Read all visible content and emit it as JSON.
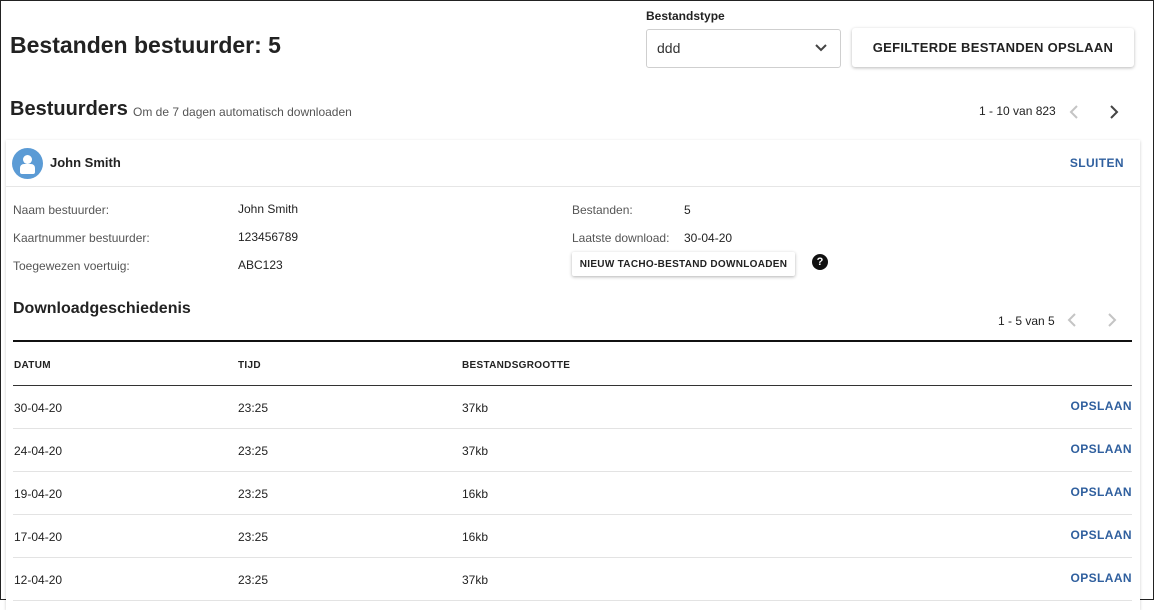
{
  "page": {
    "title": "Bestanden bestuurder: 5"
  },
  "filter": {
    "label": "Bestandstype",
    "value": "ddd",
    "save_button": "GEFILTERDE BESTANDEN OPSLAAN"
  },
  "drivers": {
    "title": "Bestuurders",
    "subtitle": "Om de 7 dagen automatisch downloaden",
    "pagination": "1 - 10 van 823"
  },
  "driver_card": {
    "name": "John Smith",
    "close_label": "SLUITEN",
    "fields_left": [
      {
        "label": "Naam bestuurder:",
        "value": "John Smith"
      },
      {
        "label": "Kaartnummer bestuurder:",
        "value": "123456789"
      },
      {
        "label": "Toegewezen voertuig:",
        "value": "ABC123"
      }
    ],
    "fields_right": [
      {
        "label": "Bestanden:",
        "value": "5"
      },
      {
        "label": "Laatste download:",
        "value": "30-04-20"
      }
    ],
    "download_button": "NIEUW TACHO-BESTAND DOWNLOADEN",
    "help_glyph": "?"
  },
  "history": {
    "title": "Downloadgeschiedenis",
    "pagination": "1 - 5 van 5",
    "columns": [
      "DATUM",
      "TIJD",
      "BESTANDSGROOTTE"
    ],
    "rows": [
      {
        "date": "30-04-20",
        "time": "23:25",
        "size": "37kb",
        "action": "OPSLAAN"
      },
      {
        "date": "24-04-20",
        "time": "23:25",
        "size": "37kb",
        "action": "OPSLAAN"
      },
      {
        "date": "19-04-20",
        "time": "23:25",
        "size": "16kb",
        "action": "OPSLAAN"
      },
      {
        "date": "17-04-20",
        "time": "23:25",
        "size": "16kb",
        "action": "OPSLAAN"
      },
      {
        "date": "12-04-20",
        "time": "23:25",
        "size": "37kb",
        "action": "OPSLAAN"
      }
    ]
  },
  "colors": {
    "link": "#2f5f9e",
    "avatar": "#5b9bd5",
    "arrow_active": "#444444",
    "arrow_disabled": "#c4c4c4"
  },
  "icons": [
    "chevron-down-icon",
    "chevron-left-icon",
    "chevron-right-icon",
    "user-icon",
    "help-icon"
  ]
}
